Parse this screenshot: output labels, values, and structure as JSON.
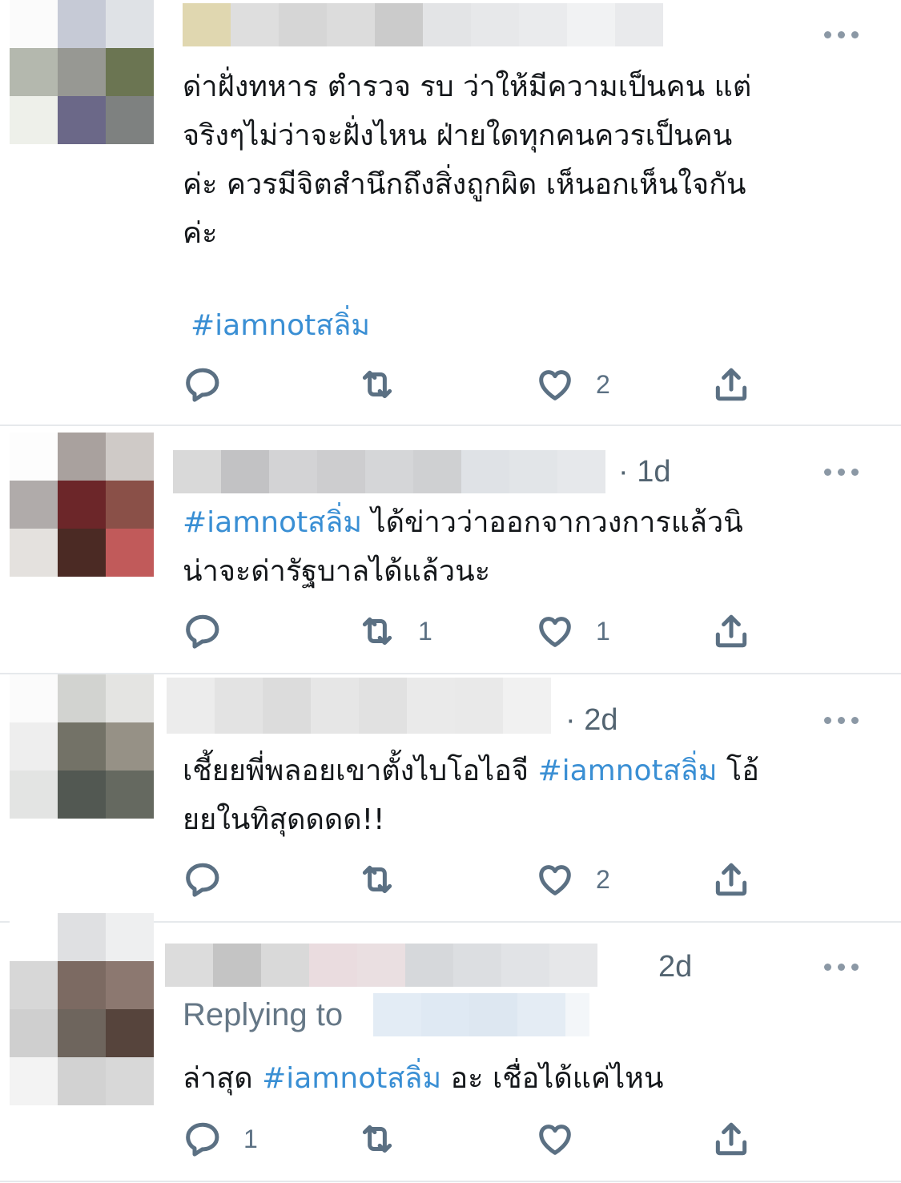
{
  "tweets": [
    {
      "time": "",
      "body": [
        {
          "text": "ด่าฝั่งทหาร ตำรวจ รบ ว่าให้มีความเป็นคน แต่",
          "hashtag": false
        },
        {
          "text": "จริงๆไม่ว่าจะฝั่งไหน ฝ่ายใดทุกคนควรเป็นคน",
          "hashtag": false
        },
        {
          "text": "ค่ะ ควรมีจิตสำนึกถึงสิ่งถูกผิด เห็นอกเห็นใจกัน",
          "hashtag": false
        },
        {
          "text": "ค่ะ",
          "hashtag": false
        }
      ],
      "hashtag_line": "#iamnotสลิ่ม",
      "replies": "",
      "retweets": "",
      "likes": "2"
    },
    {
      "time": "· 1d",
      "body_hashtag": "#iamnotสลิ่ม",
      "body_rest": " ได้ข่าวว่าออกจากวงการแล้วนิ",
      "body_line2": "น่าจะด่ารัฐบาลได้แล้วนะ",
      "replies": "",
      "retweets": "1",
      "likes": "1"
    },
    {
      "time": "· 2d",
      "body_pre": "เชี้ยยพี่พลอยเขาตั้งไบโอไอจี ",
      "body_hashtag": "#iamnotสลิ่ม",
      "body_post": " โอ้",
      "body_line2": "ยยในทิสุดดดด!!",
      "replies": "",
      "retweets": "",
      "likes": "2"
    },
    {
      "time": "2d",
      "replying_label": "Replying to",
      "body_pre": "ล่าสุด ",
      "body_hashtag": "#iamnotสลิ่ม",
      "body_post": " อะ เชื่อได้แค่ไหน",
      "replies": "1",
      "retweets": "",
      "likes": ""
    }
  ],
  "icons": {
    "reply": "reply-icon",
    "retweet": "retweet-icon",
    "like": "heart-icon",
    "share": "share-icon",
    "more": "more-icon"
  },
  "colors": {
    "hashtag": "#3a8fd4",
    "muted": "#5b7083",
    "divider": "#e6e9ec"
  }
}
